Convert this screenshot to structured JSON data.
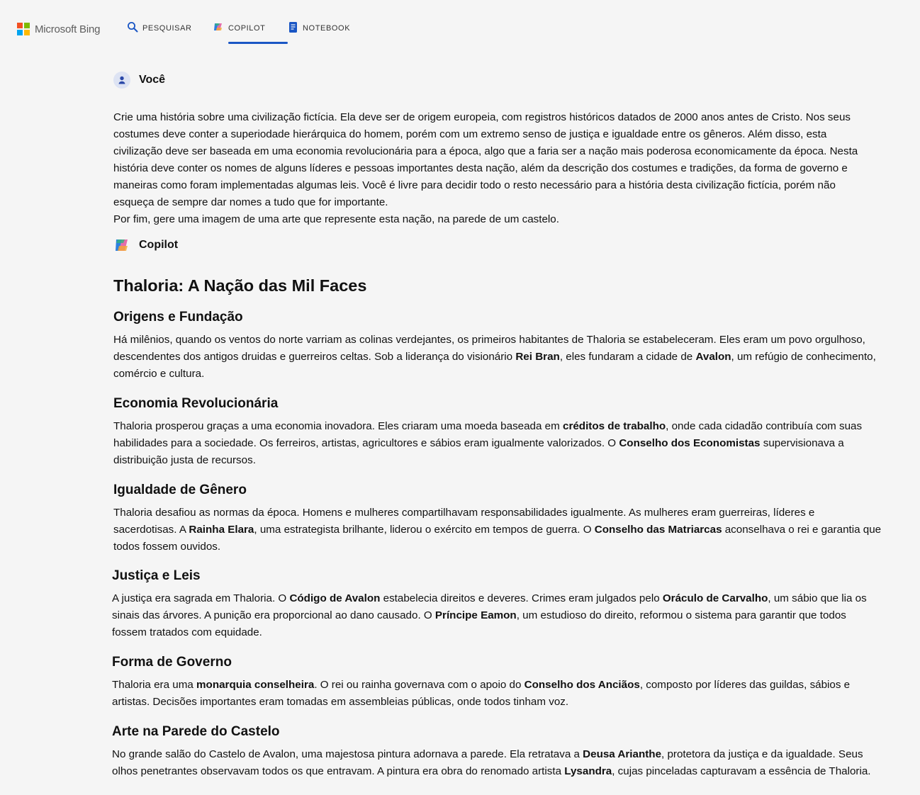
{
  "header": {
    "logo_text": "Microsoft Bing",
    "tabs": [
      {
        "label": "PESQUISAR",
        "icon": "search-icon"
      },
      {
        "label": "COPILOT",
        "icon": "copilot-icon",
        "active": true
      },
      {
        "label": "NOTEBOOK",
        "icon": "notebook-icon"
      }
    ]
  },
  "colors": {
    "accent": "#1a56c4",
    "background": "#f5f5f5",
    "ms_red": "#f25022",
    "ms_green": "#7fba00",
    "ms_blue": "#00a4ef",
    "ms_yellow": "#ffb900"
  },
  "user_message": {
    "speaker": "Você",
    "lines": [
      "Crie uma história sobre uma civilização fictícia. Ela deve ser de origem europeia, com registros históricos datados de 2000 anos antes de Cristo. Nos seus",
      "costumes deve conter a superiodade hierárquica do homem, porém com um extremo senso de justiça e igualdade entre os gêneros. Além disso, esta",
      "civilização deve ser baseada em uma economia revolucionária para a época, algo que a faria ser a nação mais poderosa economicamente da época. Nesta",
      "história deve conter os nomes de alguns líderes e pessoas importantes desta nação, além da descrição dos costumes e tradições, da forma de governo e",
      "maneiras como foram implementadas algumas leis. Você é livre para decidir todo o resto necessário para a história desta civilização fictícia, porém não",
      "esqueça de sempre dar nomes a tudo que for importante.",
      "Por fim, gere uma imagem de uma arte que represente esta nação, na parede de um castelo."
    ]
  },
  "copilot_message": {
    "speaker": "Copilot",
    "title": "Thaloria: A Nação das Mil Faces",
    "sections": [
      {
        "heading": "Origens e Fundação",
        "lines": [
          [
            {
              "t": "Há milênios, quando os ventos do norte varriam as colinas verdejantes, os primeiros habitantes de Thaloria se estabeleceram. Eles eram um povo orgulhoso,"
            }
          ],
          [
            {
              "t": "descendentes dos antigos druidas e guerreiros celtas. Sob a liderança do visionário "
            },
            {
              "t": "Rei Bran",
              "b": true
            },
            {
              "t": ", eles fundaram a cidade de "
            },
            {
              "t": "Avalon",
              "b": true
            },
            {
              "t": ", um refúgio de conhecimento,"
            }
          ],
          [
            {
              "t": "comércio e cultura."
            }
          ]
        ]
      },
      {
        "heading": "Economia Revolucionária",
        "lines": [
          [
            {
              "t": "Thaloria prosperou graças a uma economia inovadora. Eles criaram uma moeda baseada em "
            },
            {
              "t": "créditos de trabalho",
              "b": true
            },
            {
              "t": ", onde cada cidadão contribuía com suas"
            }
          ],
          [
            {
              "t": "habilidades para a sociedade. Os ferreiros, artistas, agricultores e sábios eram igualmente valorizados. O "
            },
            {
              "t": "Conselho dos Economistas",
              "b": true
            },
            {
              "t": " supervisionava a"
            }
          ],
          [
            {
              "t": "distribuição justa de recursos."
            }
          ]
        ]
      },
      {
        "heading": "Igualdade de Gênero",
        "lines": [
          [
            {
              "t": "Thaloria desafiou as normas da época. Homens e mulheres compartilhavam responsabilidades igualmente. As mulheres eram guerreiras, líderes e"
            }
          ],
          [
            {
              "t": "sacerdotisas. A "
            },
            {
              "t": "Rainha Elara",
              "b": true
            },
            {
              "t": ", uma estrategista brilhante, liderou o exército em tempos de guerra. O "
            },
            {
              "t": "Conselho das Matriarcas",
              "b": true
            },
            {
              "t": " aconselhava o rei e garantia que"
            }
          ],
          [
            {
              "t": "todos fossem ouvidos."
            }
          ]
        ]
      },
      {
        "heading": "Justiça e Leis",
        "lines": [
          [
            {
              "t": "A justiça era sagrada em Thaloria. O "
            },
            {
              "t": "Código de Avalon",
              "b": true
            },
            {
              "t": " estabelecia direitos e deveres. Crimes eram julgados pelo "
            },
            {
              "t": "Oráculo de Carvalho",
              "b": true
            },
            {
              "t": ", um sábio que lia os"
            }
          ],
          [
            {
              "t": "sinais das árvores. A punição era proporcional ao dano causado. O "
            },
            {
              "t": "Príncipe Eamon",
              "b": true
            },
            {
              "t": ", um estudioso do direito, reformou o sistema para garantir que todos"
            }
          ],
          [
            {
              "t": "fossem tratados com equidade."
            }
          ]
        ]
      },
      {
        "heading": "Forma de Governo",
        "lines": [
          [
            {
              "t": "Thaloria era uma "
            },
            {
              "t": "monarquia conselheira",
              "b": true
            },
            {
              "t": ". O rei ou rainha governava com o apoio do "
            },
            {
              "t": "Conselho dos Anciãos",
              "b": true
            },
            {
              "t": ", composto por líderes das guildas, sábios e"
            }
          ],
          [
            {
              "t": "artistas. Decisões importantes eram tomadas em assembleias públicas, onde todos tinham voz."
            }
          ]
        ]
      },
      {
        "heading": "Arte na Parede do Castelo",
        "lines": [
          [
            {
              "t": "No grande salão do Castelo de Avalon, uma majestosa pintura adornava a parede. Ela retratava a "
            },
            {
              "t": "Deusa Arianthe",
              "b": true
            },
            {
              "t": ", protetora da justiça e da igualdade. Seus"
            }
          ],
          [
            {
              "t": "olhos penetrantes observavam todos os que entravam. A pintura era obra do renomado artista "
            },
            {
              "t": "Lysandra",
              "b": true
            },
            {
              "t": ", cujas pinceladas capturavam a essência de Thaloria."
            }
          ]
        ]
      }
    ]
  }
}
